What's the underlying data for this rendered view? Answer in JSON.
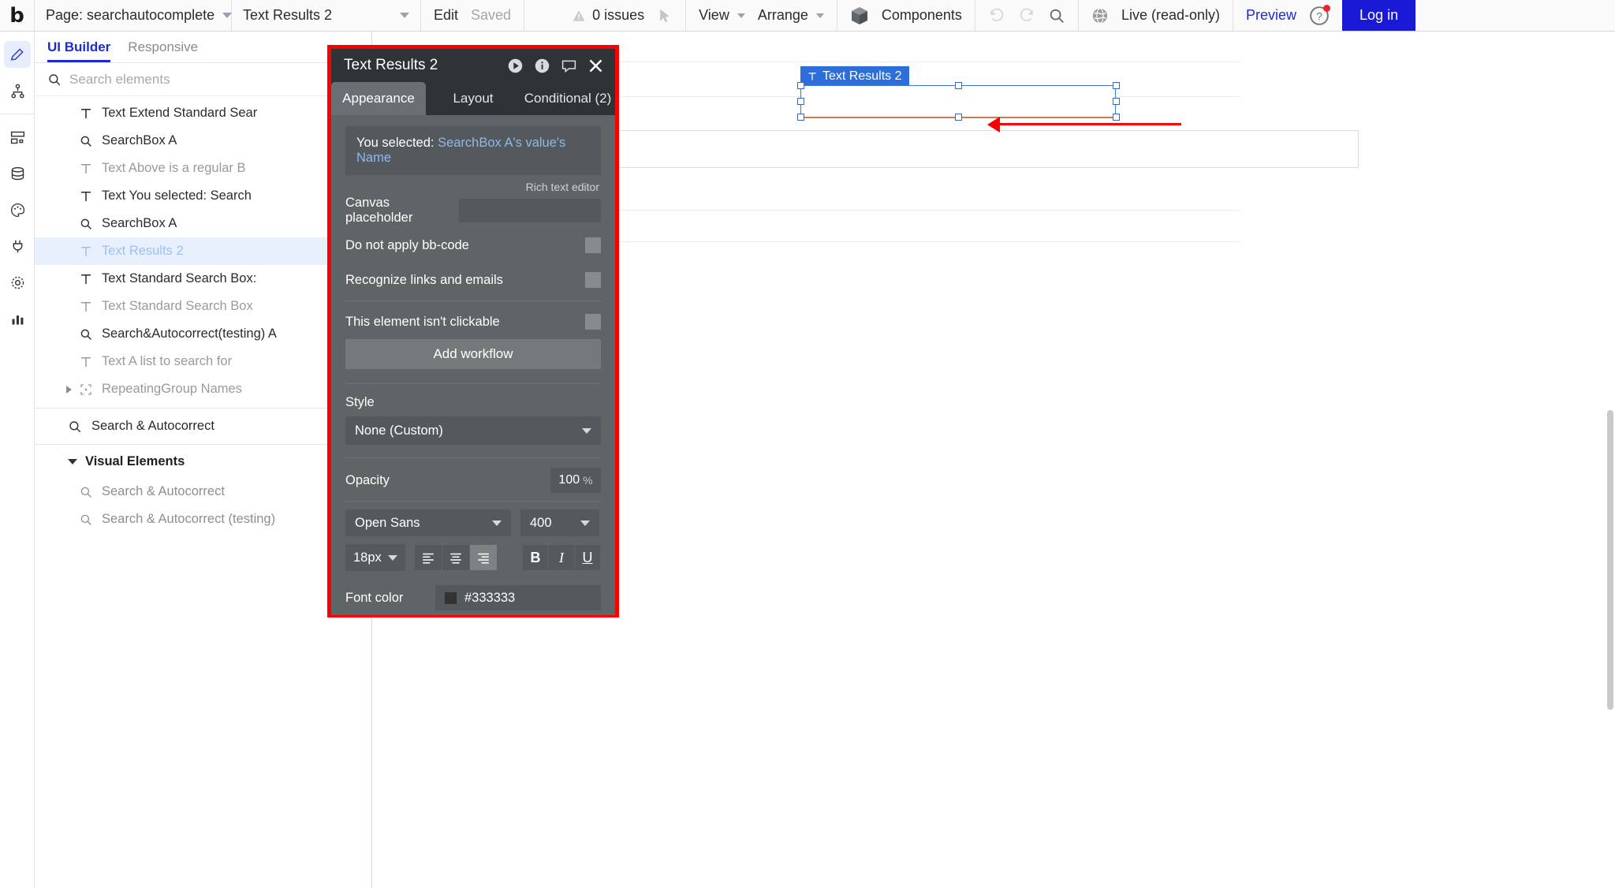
{
  "topbar": {
    "logo": "b",
    "page_selector": {
      "label": "Page: searchautocomplete",
      "icon": "chevron-down-icon"
    },
    "element_selector": {
      "label": "Text Results 2",
      "icon": "chevron-down-icon"
    },
    "edit_label": "Edit",
    "saved_label": "Saved",
    "issues_label": "0 issues",
    "view_label": "View",
    "arrange_label": "Arrange",
    "components_label": "Components",
    "live_label": "Live (read-only)",
    "preview_label": "Preview",
    "login_label": "Log in"
  },
  "rail": {
    "items": [
      {
        "name": "pencil-icon",
        "active": true
      },
      {
        "name": "sitemap-icon",
        "active": false
      },
      {
        "name": "layout-icon",
        "active": false
      },
      {
        "name": "database-icon",
        "active": false
      },
      {
        "name": "palette-icon",
        "active": false
      },
      {
        "name": "plug-icon",
        "active": false
      },
      {
        "name": "gear-icon",
        "active": false
      },
      {
        "name": "chart-icon",
        "active": false
      }
    ]
  },
  "left_panel": {
    "tabs": [
      {
        "label": "UI Builder",
        "active": true
      },
      {
        "label": "Responsive",
        "active": false
      }
    ],
    "search": {
      "placeholder": "Search elements",
      "value": ""
    },
    "tree": [
      {
        "label": "Text Extend Standard Sear",
        "icon": "text-icon",
        "dim": false,
        "selected": false,
        "arrow": false
      },
      {
        "label": "SearchBox A",
        "icon": "search-icon",
        "dim": false,
        "selected": false,
        "arrow": false
      },
      {
        "label": "Text Above is a regular B",
        "icon": "text-icon",
        "dim": true,
        "selected": false,
        "arrow": false
      },
      {
        "label": "Text You selected: Search",
        "icon": "text-icon",
        "dim": false,
        "selected": false,
        "arrow": false
      },
      {
        "label": "SearchBox A",
        "icon": "search-icon",
        "dim": false,
        "selected": false,
        "arrow": false
      },
      {
        "label": "Text Results 2",
        "icon": "text-icon",
        "dim": false,
        "selected": true,
        "arrow": false
      },
      {
        "label": "Text Standard Search Box:",
        "icon": "text-icon",
        "dim": false,
        "selected": false,
        "arrow": false
      },
      {
        "label": "Text Standard Search Box",
        "icon": "text-icon",
        "dim": true,
        "selected": false,
        "arrow": false
      },
      {
        "label": "Search&Autocorrect(testing) A",
        "icon": "search-icon",
        "dim": false,
        "selected": false,
        "arrow": false
      },
      {
        "label": "Text A list to search for",
        "icon": "text-icon",
        "dim": true,
        "selected": false,
        "arrow": false
      },
      {
        "label": "RepeatingGroup Names",
        "icon": "group-icon",
        "dim": true,
        "selected": false,
        "arrow": true
      }
    ],
    "section_row": {
      "label": "Search & Autocorrect",
      "icon": "search-icon"
    },
    "visual_elements": {
      "title": "Visual Elements",
      "items": [
        {
          "label": "Search & Autocorrect",
          "icon": "search-icon"
        },
        {
          "label": "Search & Autocorrect (testing)",
          "icon": "search-icon"
        }
      ]
    }
  },
  "canvas": {
    "selection_label": "Text Results 2",
    "selection_icon": "text-icon"
  },
  "dialog": {
    "title": "Text Results 2",
    "header_icons": [
      {
        "name": "play-circle-icon"
      },
      {
        "name": "info-circle-icon"
      },
      {
        "name": "comment-icon"
      },
      {
        "name": "close-icon"
      }
    ],
    "tabs": [
      {
        "label": "Appearance",
        "active": true
      },
      {
        "label": "Layout",
        "active": false
      },
      {
        "label": "Conditional (2)",
        "active": false
      }
    ],
    "selection_prefix": "You selected: ",
    "selection_value": "SearchBox A's value's Name",
    "rich_text_note": "Rich text editor",
    "canvas_placeholder_label": "Canvas placeholder",
    "canvas_placeholder_value": "",
    "checkbox_bbcode": "Do not apply bb-code",
    "checkbox_links": "Recognize links and emails",
    "checkbox_clickable": "This element isn't clickable",
    "add_workflow_label": "Add workflow",
    "style_label": "Style",
    "style_value": "None (Custom)",
    "opacity_label": "Opacity",
    "opacity_value": "100",
    "opacity_unit": "%",
    "font_family": "Open Sans",
    "font_weight": "400",
    "font_size": "18px",
    "align_buttons": [
      {
        "name": "align-left-icon",
        "active": false
      },
      {
        "name": "align-center-icon",
        "active": false
      },
      {
        "name": "align-right-icon",
        "active": true
      }
    ],
    "style_buttons": [
      {
        "name": "bold-icon",
        "glyph": "B"
      },
      {
        "name": "italic-icon",
        "glyph": "I"
      },
      {
        "name": "underline-icon",
        "glyph": "U"
      }
    ],
    "font_color_label": "Font color",
    "font_color_value": "#333333",
    "font_color_swatch": "#333333"
  }
}
